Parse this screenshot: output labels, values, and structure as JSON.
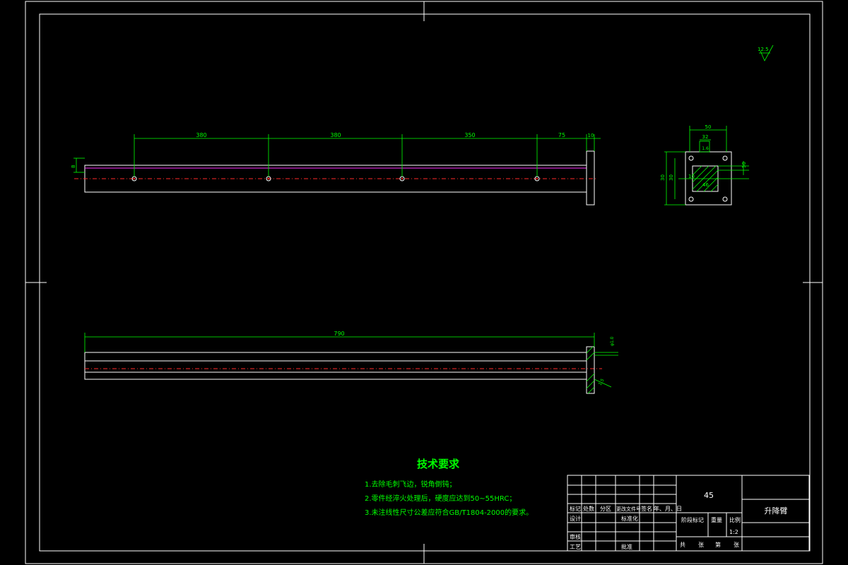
{
  "roughness": "12.5",
  "top_view_dims": [
    "380",
    "380",
    "350",
    "75",
    "10"
  ],
  "top_view_left_dim": "8",
  "side_view": {
    "top_dim": "50",
    "inner_top_dim": "32",
    "inner_mid_dim": "1.6",
    "left_dims": [
      "30",
      "30"
    ],
    "inner_left_dim": "10",
    "inner_center_dim": "46",
    "right_dim": "50"
  },
  "front_view_length": "790",
  "front_view_right_dim": "φ1.0",
  "front_view_chamfer": "1.5",
  "tech_req": {
    "title": "技术要求",
    "items": [
      "1.去除毛刺飞边，锐角倒钝；",
      "2.零件经淬火处理后，硬度应达到50~55HRC；",
      "3.未注线性尺寸公差应符合GB/T1804-2000的要求。"
    ]
  },
  "title_block": {
    "material": "45",
    "part_name": "升降臂",
    "labels_row": [
      "标记",
      "处数",
      "分区",
      "更改文件号",
      "签名",
      "年、月、日"
    ],
    "design": "设计",
    "standardize": "标准化",
    "review": "审核",
    "process": "工艺",
    "approve": "批准",
    "stage_mark": "阶段标记",
    "weight": "重量",
    "scale_label": "比例",
    "scale_value": "1:2",
    "sheets": [
      "共",
      "张",
      "第",
      "张"
    ]
  }
}
